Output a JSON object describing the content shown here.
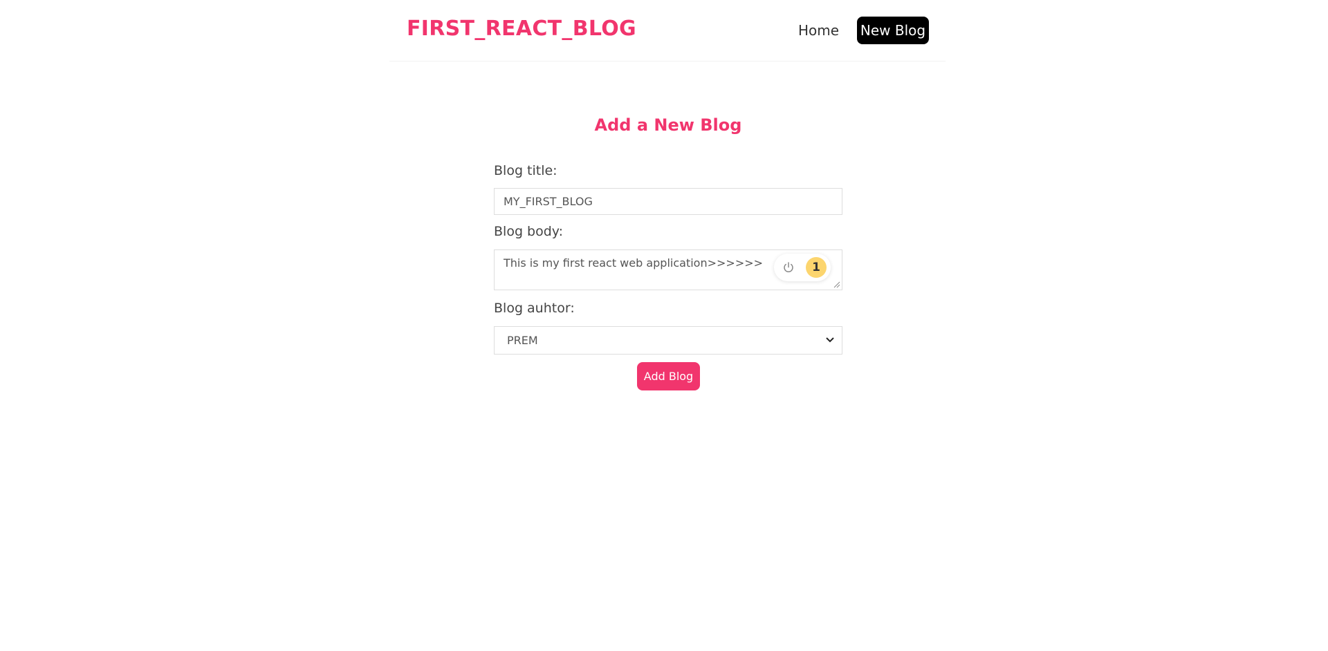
{
  "navbar": {
    "logo": "FIRST_REACT_BLOG",
    "links": [
      {
        "label": "Home"
      },
      {
        "label": "New Blog"
      }
    ]
  },
  "form": {
    "heading": "Add a New Blog",
    "title_label": "Blog title:",
    "title_value": "MY_FIRST_BLOG",
    "body_label": "Blog body:",
    "body_value": "This is my first react web application>>>>>>",
    "author_label": "Blog auhtor:",
    "author_value": "PREM",
    "submit_label": "Add Blog"
  },
  "widget": {
    "icon": "power-icon",
    "count": "1"
  },
  "colors": {
    "accent": "#f1356d",
    "active_nav_bg": "#000000",
    "badge": "#fcd56e"
  }
}
